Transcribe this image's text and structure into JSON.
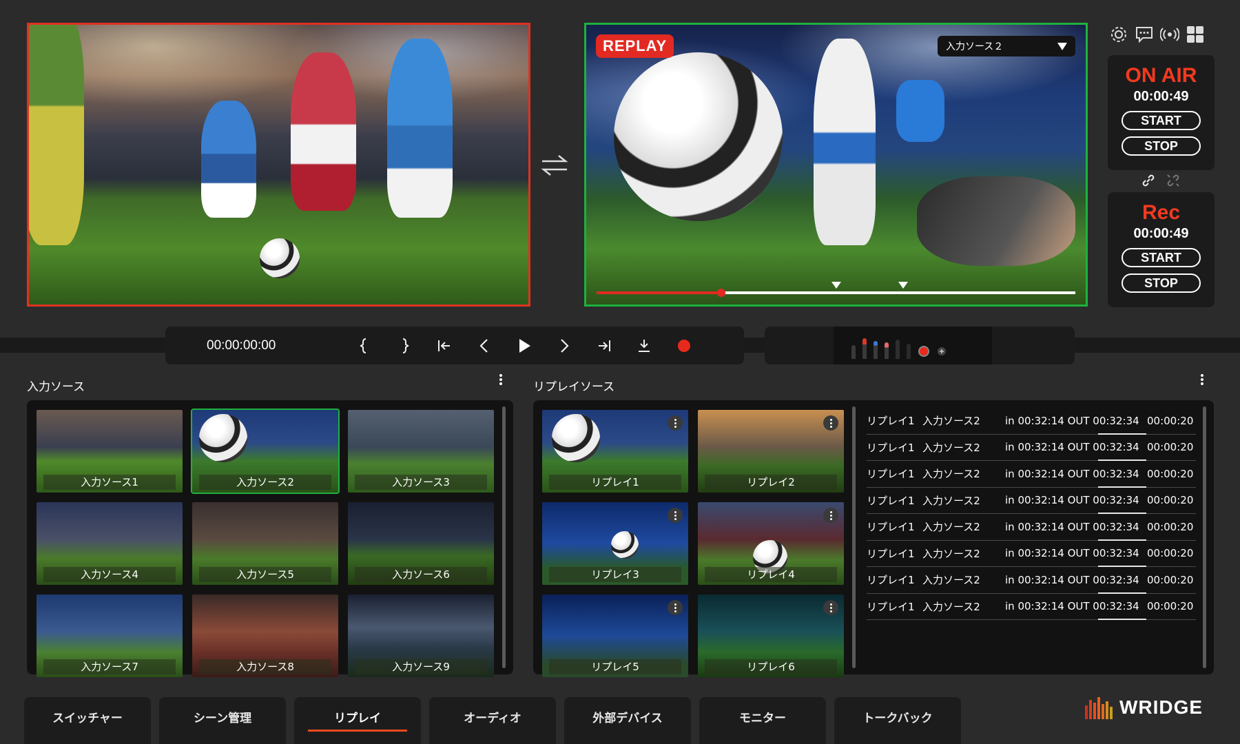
{
  "program": {
    "label": ""
  },
  "preview": {
    "badge": "REPLAY",
    "source_select": "入力ソース２",
    "timeline_progress": 0.26,
    "markers": [
      0.5,
      0.64
    ]
  },
  "status": {
    "on_air": {
      "title": "ON AIR",
      "time": "00:00:49",
      "start": "START",
      "stop": "STOP"
    },
    "rec": {
      "title": "Rec",
      "time": "00:00:49",
      "start": "START",
      "stop": "STOP"
    }
  },
  "transport": {
    "timecode": "00:00:00:00"
  },
  "input_panel": {
    "title": "入力ソース",
    "sources": [
      "入力ソース1",
      "入力ソース2",
      "入力ソース3",
      "入力ソース4",
      "入力ソース5",
      "入力ソース6",
      "入力ソース7",
      "入力ソース8",
      "入力ソース9"
    ],
    "selected_index": 1
  },
  "replay_panel": {
    "title": "リプレイソース",
    "clips": [
      "リプレイ1",
      "リプレイ2",
      "リプレイ3",
      "リプレイ4",
      "リプレイ5",
      "リプレイ6"
    ],
    "list": [
      {
        "name": "リプレイ1",
        "source": "入力ソース2",
        "inout": "in 00:32:14 OUT 00:32:34",
        "dur": "00:00:20"
      },
      {
        "name": "リプレイ1",
        "source": "入力ソース2",
        "inout": "in 00:32:14 OUT 00:32:34",
        "dur": "00:00:20"
      },
      {
        "name": "リプレイ1",
        "source": "入力ソース2",
        "inout": "in 00:32:14 OUT 00:32:34",
        "dur": "00:00:20"
      },
      {
        "name": "リプレイ1",
        "source": "入力ソース2",
        "inout": "in 00:32:14 OUT 00:32:34",
        "dur": "00:00:20"
      },
      {
        "name": "リプレイ1",
        "source": "入力ソース2",
        "inout": "in 00:32:14 OUT 00:32:34",
        "dur": "00:00:20"
      },
      {
        "name": "リプレイ1",
        "source": "入力ソース2",
        "inout": "in 00:32:14 OUT 00:32:34",
        "dur": "00:00:20"
      },
      {
        "name": "リプレイ1",
        "source": "入力ソース2",
        "inout": "in 00:32:14 OUT 00:32:34",
        "dur": "00:00:20"
      },
      {
        "name": "リプレイ1",
        "source": "入力ソース2",
        "inout": "in 00:32:14 OUT 00:32:34",
        "dur": "00:00:20"
      }
    ]
  },
  "tabs": [
    "スイッチャー",
    "シーン管理",
    "リプレイ",
    "オーディオ",
    "外部デバイス",
    "モニター",
    "トークバック"
  ],
  "active_tab": 2,
  "brand": {
    "name": "WRIDGE"
  },
  "colors": {
    "program_border": "#e0321f",
    "preview_border": "#1eb140",
    "accent": "#f04a1e",
    "record": "#e82a1c"
  }
}
